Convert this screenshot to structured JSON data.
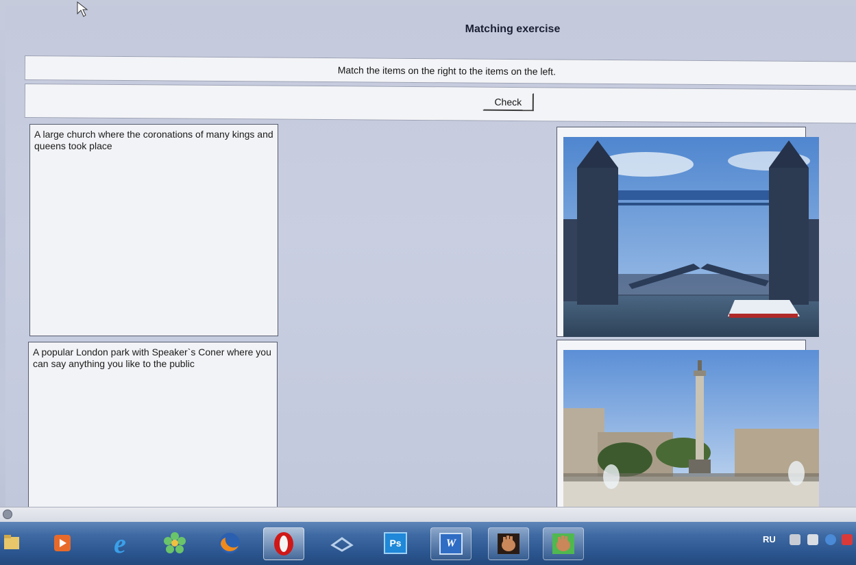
{
  "window": {
    "title": "Matching exercise"
  },
  "instructions": {
    "text": "Match the items on the right to the items on the left."
  },
  "toolbar": {
    "check_label": "Check"
  },
  "left_items": [
    {
      "text": "A large church where the coronations of many kings and queens took place"
    },
    {
      "text": "A popular London park with Speaker`s Coner where you can say anything you like to the public"
    }
  ],
  "taskbar": {
    "items": [
      {
        "icon": "windows-explorer-icon"
      },
      {
        "icon": "media-player-icon"
      },
      {
        "icon": "internet-explorer-icon"
      },
      {
        "icon": "icq-flower-icon"
      },
      {
        "icon": "firefox-icon"
      },
      {
        "icon": "opera-icon"
      },
      {
        "icon": "app-icon"
      },
      {
        "icon": "photoshop-icon"
      },
      {
        "icon": "word-icon"
      },
      {
        "icon": "hand-app-icon"
      },
      {
        "icon": "hand-app-icon"
      }
    ],
    "photoshop_label": "Ps",
    "word_label": "W",
    "language": "RU"
  },
  "colors": {
    "taskbar": "#2b5690",
    "page_background": "#c6cbdc",
    "panel": "#f3f4f7"
  }
}
